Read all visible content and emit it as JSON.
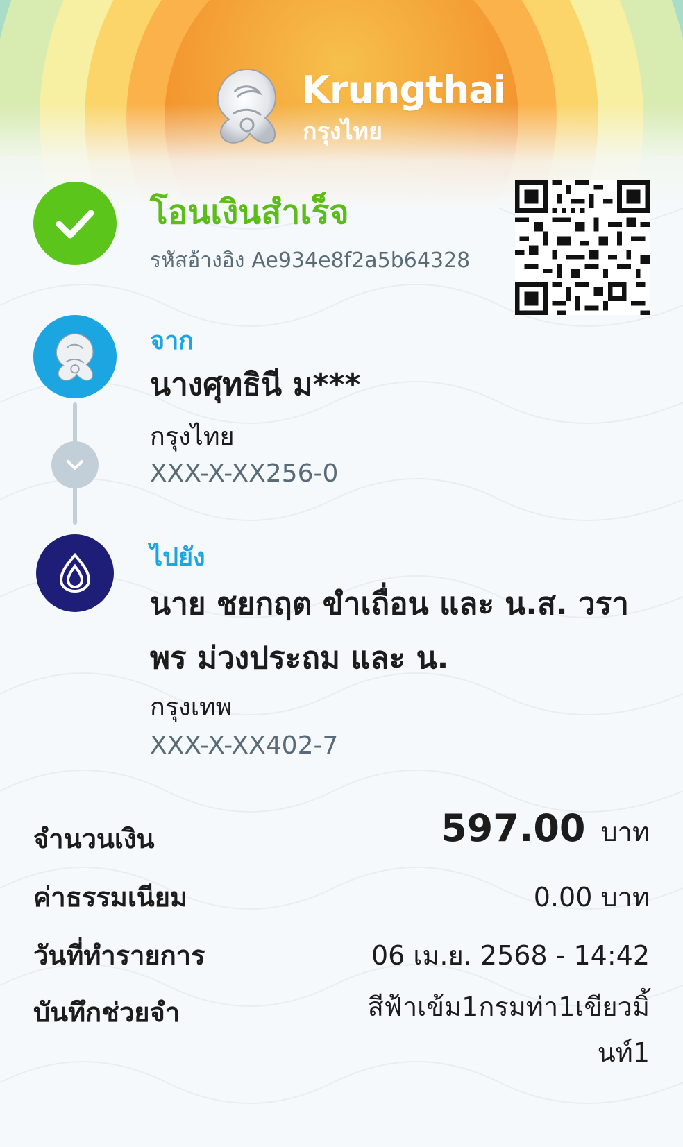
{
  "header": {
    "brand_en": "Krungthai",
    "brand_th": "กรุงไทย"
  },
  "status": {
    "title": "โอนเงินสำเร็จ",
    "ref_label": "รหัสอ้างอิง",
    "ref_value": "Ae934e8f2a5b64328"
  },
  "from": {
    "label": "จาก",
    "name": "นางศุทธินี ม***",
    "bank": "กรุงไทย",
    "account": "XXX-X-XX256-0"
  },
  "to": {
    "label": "ไปยัง",
    "name": "นาย ชยกฤต ขำเถื่อน และ น.ส. วราพร ม่วงประถม และ น.",
    "bank": "กรุงเทพ",
    "account": "XXX-X-XX402-7"
  },
  "details": {
    "amount_label": "จำนวนเงิน",
    "amount_value": "597.00",
    "amount_unit": "บาท",
    "fee_label": "ค่าธรรมเนียม",
    "fee_value": "0.00 บาท",
    "date_label": "วันที่ทำรายการ",
    "date_value": "06 เม.ย. 2568 - 14:42",
    "note_label": "บันทึกช่วยจำ",
    "note_value": "สีฟ้าเข้ม1กรมท่า1เขียวมิ้นท์1"
  },
  "colors": {
    "success_green": "#5cc51c",
    "krungthai_blue": "#1ba5e1",
    "bangkok_bank_navy": "#1e1e78",
    "muted_gray": "#5a6b78"
  },
  "icons": {
    "status": "check-icon",
    "from_bank": "krungthai-bird-logo",
    "to_bank": "bangkok-bank-lotus-logo",
    "expand": "chevron-down-icon"
  }
}
